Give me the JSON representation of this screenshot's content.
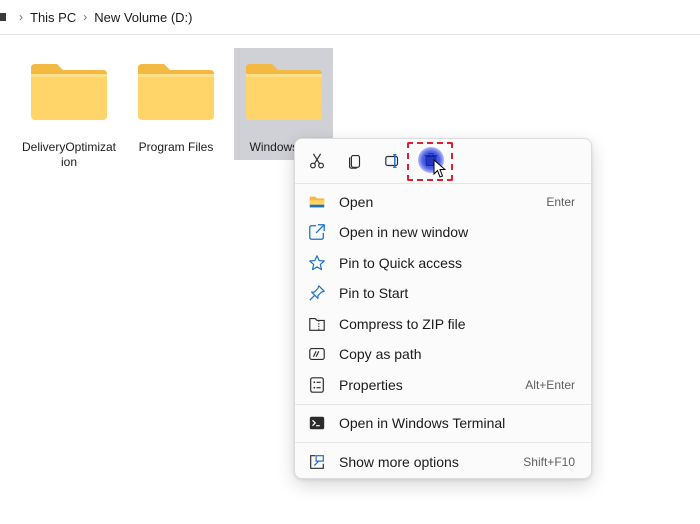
{
  "breadcrumb": {
    "items": [
      "This PC",
      "New Volume (D:)"
    ],
    "separator": ">"
  },
  "folders": [
    {
      "label": "DeliveryOptimization",
      "selected": false
    },
    {
      "label": "Program Files",
      "selected": false
    },
    {
      "label": "Windows",
      "selected": true
    }
  ],
  "context_menu": {
    "quick_actions": [
      {
        "icon": "scissors-icon",
        "name": "cut"
      },
      {
        "icon": "copy-icon",
        "name": "copy"
      },
      {
        "icon": "rename-icon",
        "name": "rename"
      },
      {
        "icon": "trash-icon",
        "name": "delete",
        "highlighted": true
      }
    ],
    "items": [
      {
        "label": "Open",
        "shortcut": "Enter",
        "icon": "folder-icon"
      },
      {
        "label": "Open in new window",
        "shortcut": "",
        "icon": "open-new-window-icon"
      },
      {
        "label": "Pin to Quick access",
        "shortcut": "",
        "icon": "star-icon"
      },
      {
        "label": "Pin to Start",
        "shortcut": "",
        "icon": "pin-icon"
      },
      {
        "label": "Compress to ZIP file",
        "shortcut": "",
        "icon": "zip-icon"
      },
      {
        "label": "Copy as path",
        "shortcut": "",
        "icon": "copy-path-icon"
      },
      {
        "label": "Properties",
        "shortcut": "Alt+Enter",
        "icon": "properties-icon"
      },
      {
        "label": "Open in Windows Terminal",
        "shortcut": "",
        "icon": "terminal-icon"
      },
      {
        "label": "Show more options",
        "shortcut": "Shift+F10",
        "icon": "more-options-icon"
      }
    ]
  },
  "colors": {
    "folder_body": "#FFD56A",
    "folder_tab": "#F4B942",
    "selection": "#CFD1D6",
    "highlight_border": "#E0202A",
    "icon_blue": "#1a6fc7"
  }
}
